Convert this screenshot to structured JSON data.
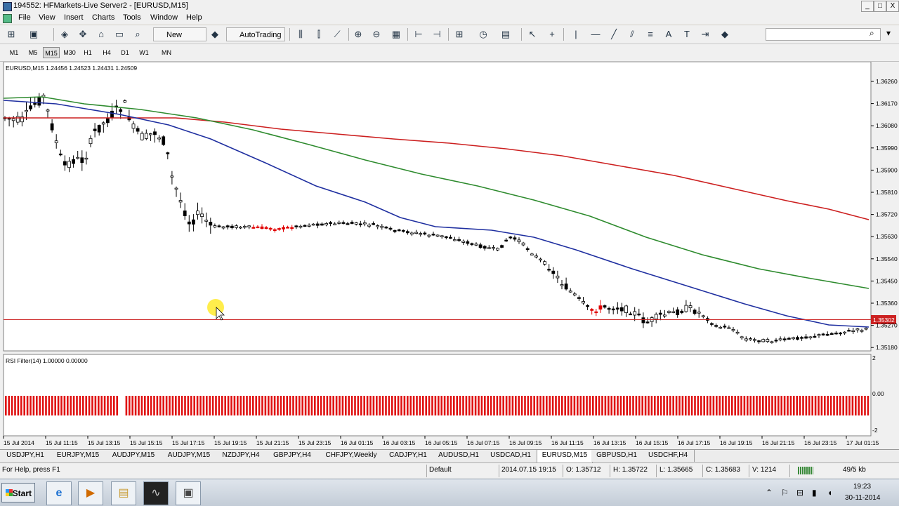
{
  "window": {
    "title": "194552: HFMarkets-Live Server2 - [EURUSD,M15]",
    "min_label": "_",
    "max_label": "□",
    "close_label": "X"
  },
  "menu": [
    "File",
    "View",
    "Insert",
    "Charts",
    "Tools",
    "Window",
    "Help"
  ],
  "toolbar": {
    "new_order_label": "New Order",
    "autotrading_label": "AutoTrading"
  },
  "search": {
    "placeholder": ""
  },
  "timeframes": {
    "items": [
      "M1",
      "M5",
      "M15",
      "M30",
      "H1",
      "H4",
      "D1",
      "W1",
      "MN"
    ],
    "selected": "M15"
  },
  "chart": {
    "header": "EURUSD,M15  1.24456 1.24523 1.24431 1.24509",
    "price_ticks": [
      "1.36260",
      "1.36170",
      "1.36080",
      "1.35990",
      "1.35900",
      "1.35810",
      "1.35720",
      "1.35630",
      "1.35540",
      "1.35450",
      "1.35360",
      "1.35270",
      "1.35180"
    ],
    "current_price_label": "1.35302",
    "time_ticks": [
      "15 Jul 2014",
      "15 Jul 11:15",
      "15 Jul 13:15",
      "15 Jul 15:15",
      "15 Jul 17:15",
      "15 Jul 19:15",
      "15 Jul 21:15",
      "15 Jul 23:15",
      "16 Jul 01:15",
      "16 Jul 03:15",
      "16 Jul 05:15",
      "16 Jul 07:15",
      "16 Jul 09:15",
      "16 Jul 11:15",
      "16 Jul 13:15",
      "16 Jul 15:15",
      "16 Jul 17:15",
      "16 Jul 19:15",
      "16 Jul 21:15",
      "16 Jul 23:15",
      "17 Jul 01:15"
    ],
    "colors": {
      "ma_blue": "#1f2fa0",
      "ma_green": "#2e8b2e",
      "ma_red": "#cc1f1f",
      "bull": "#000000",
      "bear_red": "#e00000",
      "hline": "#cc2222"
    },
    "indicator": {
      "label": "RSI Filter(14) 1.00000 0.00000",
      "ticks": [
        "2",
        "0.00",
        "-2"
      ],
      "bar_color": "#e01010"
    }
  },
  "tabs": [
    "USDJPY,H1",
    "EURJPY,M15",
    "AUDJPY,M15",
    "AUDJPY,M15",
    "NZDJPY,H4",
    "GBPJPY,H4",
    "CHFJPY,Weekly",
    "CADJPY,H1",
    "AUDUSD,H1",
    "USDCAD,H1",
    "EURUSD,M15",
    "GBPUSD,H1",
    "USDCHF,H4"
  ],
  "active_tab": "EURUSD,M15",
  "status": {
    "help": "For Help, press F1",
    "profile": "Default",
    "time": "2014.07.15 19:15",
    "open": "O: 1.35712",
    "high": "H: 1.35722",
    "low": "L: 1.35665",
    "close": "C: 1.35683",
    "volume": "V: 1214",
    "traffic": "49/5 kb"
  },
  "taskbar": {
    "start_label": "Start",
    "time": "19:23",
    "date": "30-11-2014"
  }
}
